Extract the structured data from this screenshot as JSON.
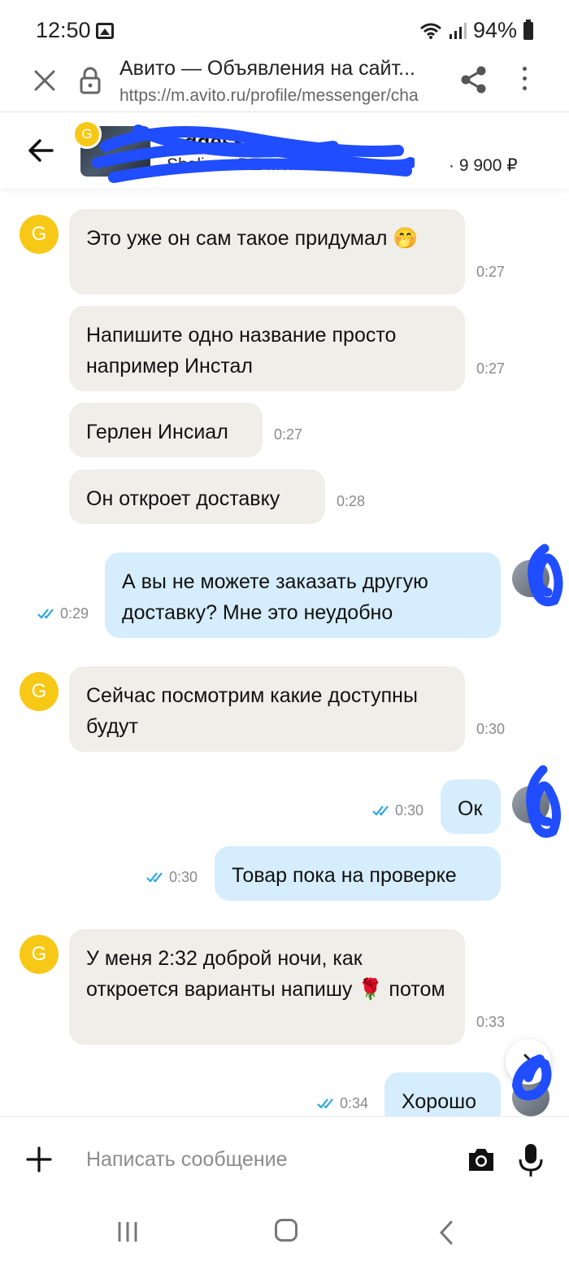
{
  "status_bar": {
    "time": "12:50",
    "battery": "94%"
  },
  "browser": {
    "title": "Авито — Объявления на сайт...",
    "url": "https://m.avito.ru/profile/messenger/cha"
  },
  "chat_header": {
    "title": "...ddess",
    "subtitle": "Shali... ...DE ...cre Gu...",
    "price": "· 9 900 ₽",
    "avatar_letter": "G"
  },
  "messages": [
    {
      "dir": "in",
      "text": "Это уже он сам такое придумал 🤭",
      "time": "0:27",
      "avatar": "G"
    },
    {
      "dir": "in",
      "text": "Напишите одно название просто например Инстал",
      "time": "0:27"
    },
    {
      "dir": "in",
      "text": "Герлен Инсиал",
      "time": "0:27"
    },
    {
      "dir": "in",
      "text": "Он откроет доставку",
      "time": "0:28"
    },
    {
      "dir": "out",
      "text": "А вы не можете заказать другую доставку? Мне это неудобно",
      "time": "0:29"
    },
    {
      "dir": "in",
      "text": "Сейчас посмотрим какие доступны будут",
      "time": "0:30",
      "avatar": "G"
    },
    {
      "dir": "out",
      "text": "Ок",
      "time": "0:30"
    },
    {
      "dir": "out",
      "text": "Товар пока на проверке",
      "time": "0:30"
    },
    {
      "dir": "in",
      "text": "У меня 2:32 доброй ночи, как откроется варианты напишу 🌹 потом",
      "time": "0:33",
      "avatar": "G"
    },
    {
      "dir": "out",
      "text": "Хорошо",
      "time": "0:34"
    }
  ],
  "composer": {
    "placeholder": "Написать сообщение"
  },
  "colors": {
    "incoming_bubble": "#f0eee9",
    "outgoing_bubble": "#d5edfd",
    "avatar_yellow": "#f7c816",
    "read_check": "#2aa5e8",
    "scribble_blue": "#1f4dff"
  },
  "icons": [
    "close-icon",
    "lock-icon",
    "share-icon",
    "more-icon",
    "back-icon",
    "plus-icon",
    "camera-icon",
    "microphone-icon",
    "double-check-icon",
    "chevron-down-icon"
  ]
}
